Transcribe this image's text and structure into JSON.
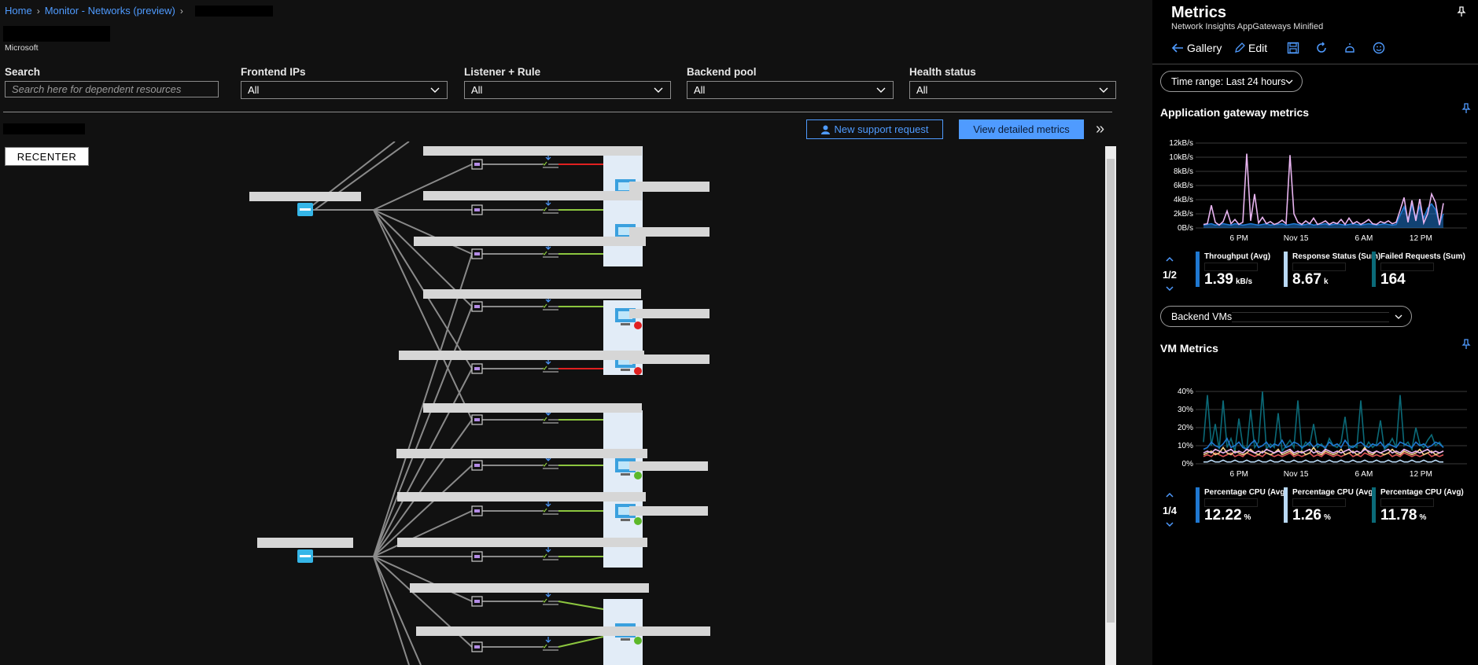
{
  "breadcrumb": {
    "home": "Home",
    "section": "Monitor - Networks (preview)"
  },
  "header": {
    "subtitle": "Microsoft"
  },
  "filters": {
    "search_label": "Search",
    "search_placeholder": "Search here for dependent resources",
    "frontend_label": "Frontend IPs",
    "frontend_value": "All",
    "listener_label": "Listener + Rule",
    "listener_value": "All",
    "backend_label": "Backend pool",
    "backend_value": "All",
    "health_label": "Health status",
    "health_value": "All"
  },
  "toolbar": {
    "support_label": "New support request",
    "metrics_label": "View detailed metrics",
    "recenter_label": "RECENTER"
  },
  "panel": {
    "title": "Metrics",
    "subtitle": "Network Insights AppGateways Minified",
    "gallery": "Gallery",
    "edit": "Edit",
    "time_range": "Time range: Last 24 hours",
    "appgw_title": "Application gateway metrics",
    "appgw_pager": "1/2",
    "backend_vms_label": "Backend VMs:",
    "vm_title": "VM Metrics",
    "vm_pager": "1/4",
    "appgw_tiles": [
      {
        "name": "Throughput (Avg)",
        "value": "1.39",
        "unit": "kB/s",
        "color": "#1f78d1"
      },
      {
        "name": "Response Status (Sum)",
        "value": "8.67",
        "unit": "k",
        "color": "#b9d9f5"
      },
      {
        "name": "Failed Requests (Sum)",
        "value": "164",
        "unit": "",
        "color": "#0b6a78"
      }
    ],
    "vm_tiles": [
      {
        "name": "Percentage CPU (Avg)",
        "value": "12.22",
        "unit": "%",
        "color": "#1f78d1"
      },
      {
        "name": "Percentage CPU (Avg)",
        "value": "1.26",
        "unit": "%",
        "color": "#b9d9f5"
      },
      {
        "name": "Percentage CPU (Avg)",
        "value": "11.78",
        "unit": "%",
        "color": "#0b6a78"
      }
    ]
  },
  "chart_data": [
    {
      "type": "area",
      "title": "Application gateway metrics",
      "ylim": [
        0,
        12
      ],
      "yticks": [
        "12kB/s",
        "10kB/s",
        "8kB/s",
        "6kB/s",
        "4kB/s",
        "2kB/s",
        "0B/s"
      ],
      "xticks": [
        "6 PM",
        "Nov 15",
        "6 AM",
        "12 PM"
      ],
      "series": [
        {
          "values": [
            0.5,
            0.6,
            3.2,
            0.8,
            0.4,
            0.9,
            2.4,
            0.6,
            1.2,
            0.5,
            0.8,
            10.5,
            1.0,
            4.8,
            0.7,
            1.5,
            0.6,
            0.9,
            0.5,
            0.7,
            1.1,
            0.6,
            10.3,
            2.0,
            0.8,
            0.5,
            1.0,
            0.6,
            1.4,
            0.5,
            0.7,
            1.0,
            0.5,
            0.8,
            0.6,
            1.2,
            0.5,
            1.4,
            0.6,
            0.9,
            0.5,
            0.8,
            1.2,
            0.6,
            0.5,
            0.9,
            0.7,
            1.0,
            0.6,
            0.8,
            2.5,
            4.3,
            0.8,
            3.9,
            1.0,
            4.1,
            0.7,
            2.0,
            4.8,
            3.6,
            0.4,
            3.5
          ],
          "color": "#e8b4f0"
        },
        {
          "values": [
            0.4,
            0.5,
            0.6,
            0.4,
            0.5,
            0.6,
            0.5,
            0.4,
            0.6,
            0.5,
            0.4,
            0.5,
            0.6,
            0.5,
            0.4,
            0.5,
            0.6,
            0.4,
            0.5,
            0.5,
            0.6,
            0.4,
            0.5,
            0.6,
            0.5,
            0.4,
            0.5,
            0.6,
            0.4,
            0.5,
            0.5,
            0.6,
            0.4,
            0.5,
            0.6,
            0.5,
            0.4,
            0.5,
            0.6,
            0.5,
            0.4,
            0.5,
            0.6,
            0.5,
            0.4,
            0.5,
            0.6,
            0.5,
            0.4,
            0.5,
            1.8,
            3.0,
            1.2,
            3.2,
            1.5,
            3.0,
            1.4,
            2.8,
            3.4,
            2.6,
            0.6,
            2.0
          ],
          "color": "#1f78d1"
        }
      ]
    },
    {
      "type": "line",
      "title": "VM Metrics",
      "ylim": [
        0,
        40
      ],
      "yticks": [
        "40%",
        "30%",
        "20%",
        "10%",
        "0%"
      ],
      "xticks": [
        "6 PM",
        "Nov 15",
        "6 AM",
        "12 PM"
      ],
      "series": [
        {
          "values": [
            12,
            38,
            10,
            22,
            8,
            35,
            9,
            14,
            7,
            25,
            10,
            8,
            30,
            9,
            12,
            40,
            8,
            11,
            9,
            28,
            7,
            10,
            13,
            9,
            35,
            8,
            12,
            10,
            22,
            9,
            11,
            8,
            14,
            10,
            9,
            12,
            26,
            8,
            10,
            9,
            35,
            8,
            12,
            9,
            11,
            24,
            8,
            10,
            14,
            9,
            38,
            10,
            12,
            8,
            20,
            11,
            9,
            13,
            16,
            10,
            12,
            9
          ],
          "color": "#0b6a78"
        },
        {
          "values": [
            8,
            9,
            12,
            10,
            9,
            11,
            14,
            9,
            10,
            12,
            9,
            8,
            11,
            13,
            9,
            10,
            12,
            9,
            11,
            10,
            13,
            9,
            10,
            12,
            11,
            9,
            10,
            12,
            9,
            11,
            10,
            9,
            12,
            10,
            11,
            9,
            13,
            10,
            9,
            11,
            12,
            10,
            9,
            11,
            10,
            12,
            9,
            11,
            10,
            9,
            12,
            11,
            10,
            9,
            12,
            10,
            11,
            9,
            10,
            12,
            11,
            9
          ],
          "color": "#1f78d1"
        },
        {
          "values": [
            4,
            5,
            4,
            6,
            5,
            4,
            5,
            6,
            4,
            5,
            4,
            6,
            5,
            4,
            5,
            4,
            6,
            5,
            4,
            5,
            4,
            5,
            6,
            4,
            5,
            4,
            5,
            6,
            4,
            5,
            4,
            6,
            5,
            4,
            5,
            4,
            5,
            6,
            4,
            5,
            4,
            6,
            5,
            4,
            5,
            4,
            5,
            6,
            4,
            5,
            4,
            6,
            5,
            4,
            5,
            4,
            5,
            6,
            4,
            5,
            4,
            5
          ],
          "color": "#e05555"
        },
        {
          "values": [
            5,
            6,
            7,
            5,
            6,
            9,
            6,
            5,
            7,
            6,
            5,
            6,
            8,
            6,
            5,
            7,
            6,
            5,
            6,
            8,
            5,
            6,
            7,
            5,
            6,
            7,
            5,
            6,
            9,
            6,
            5,
            7,
            6,
            5,
            6,
            8,
            5,
            6,
            7,
            5,
            6,
            9,
            6,
            5,
            7,
            6,
            5,
            6,
            8,
            6,
            5,
            7,
            6,
            5,
            6,
            8,
            5,
            6,
            7,
            5,
            6,
            7
          ],
          "color": "#f2d08a"
        },
        {
          "values": [
            6,
            7,
            6,
            8,
            7,
            6,
            7,
            8,
            6,
            7,
            6,
            8,
            7,
            6,
            7,
            6,
            8,
            7,
            6,
            7,
            6,
            7,
            8,
            6,
            7,
            6,
            7,
            8,
            6,
            7,
            6,
            8,
            7,
            6,
            7,
            6,
            7,
            8,
            6,
            7,
            6,
            8,
            7,
            6,
            7,
            6,
            7,
            8,
            6,
            7,
            6,
            8,
            7,
            6,
            7,
            6,
            7,
            8,
            6,
            7,
            6,
            7
          ],
          "color": "#e8b4f0"
        },
        {
          "values": [
            1,
            1,
            2,
            1,
            1,
            2,
            1,
            1,
            2,
            1,
            1,
            2,
            1,
            1,
            2,
            1,
            1,
            2,
            1,
            1,
            2,
            1,
            1,
            2,
            1,
            1,
            2,
            1,
            1,
            2,
            1,
            1,
            2,
            1,
            1,
            2,
            1,
            1,
            2,
            1,
            1,
            2,
            1,
            1,
            2,
            1,
            1,
            2,
            1,
            1,
            2,
            1,
            1,
            2,
            1,
            1,
            2,
            1,
            1,
            2,
            1,
            1
          ],
          "color": "#b9d9f5"
        }
      ]
    }
  ]
}
